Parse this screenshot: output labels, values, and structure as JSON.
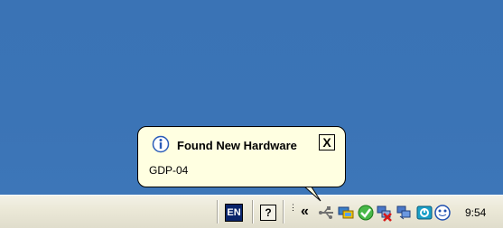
{
  "balloon": {
    "title": "Found New Hardware",
    "message": "GDP-04",
    "close_glyph": "X",
    "title_icon": "info-icon"
  },
  "taskbar": {
    "language": "EN",
    "help_glyph": "?",
    "grip_glyph": "⋮",
    "expand_glyph": "«",
    "clock": "9:54",
    "tray_icons": [
      "usb-icon",
      "network-computer-icon",
      "check-shield-icon",
      "network-disconnected-icon",
      "connection-icon",
      "power-icon",
      "face-icon"
    ]
  },
  "colors": {
    "desktop": "#3a6ea5",
    "taskbar": "#ece9d8",
    "balloon": "#ffffe1",
    "lang_badge": "#0a246a"
  }
}
